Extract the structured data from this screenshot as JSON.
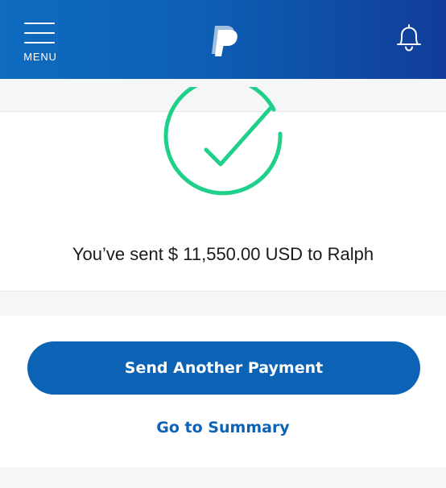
{
  "header": {
    "menu_label": "MENU",
    "menu_icon": "hamburger-icon",
    "logo_icon": "paypal-logo",
    "notification_icon": "bell-icon",
    "gradient_start": "#0e6bbf",
    "gradient_end": "#113d99"
  },
  "confirmation": {
    "status_icon": "checkmark-circle-icon",
    "status_color": "#1fd08a",
    "message": "You’ve sent $ 11,550.00 USD to Ralph"
  },
  "actions": {
    "primary_label": "Send Another Payment",
    "secondary_label": "Go to Summary",
    "accent_color": "#0c63b6"
  }
}
